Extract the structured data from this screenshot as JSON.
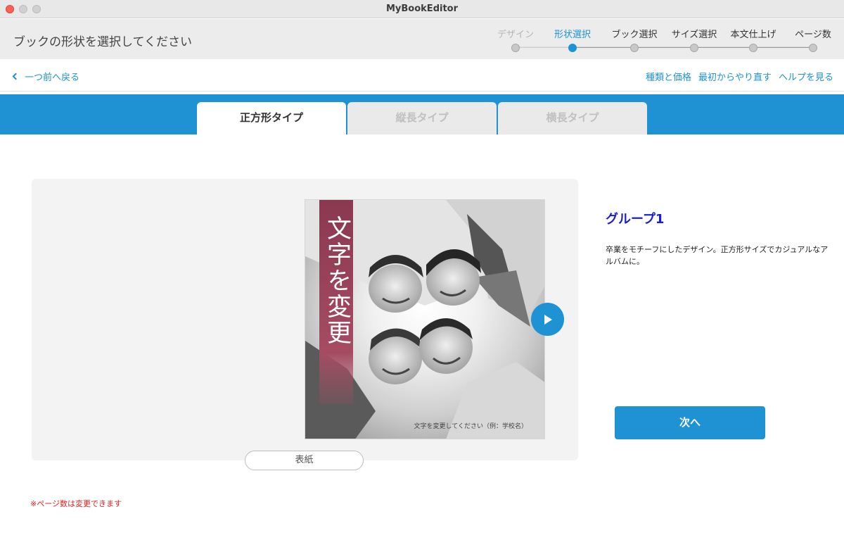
{
  "window": {
    "title": "MyBookEditor"
  },
  "header": {
    "heading": "ブックの形状を選択してください",
    "steps": [
      {
        "label": "デザイン",
        "state": "done"
      },
      {
        "label": "形状選択",
        "state": "active"
      },
      {
        "label": "ブック選択",
        "state": "pending"
      },
      {
        "label": "サイズ選択",
        "state": "pending"
      },
      {
        "label": "本文仕上げ",
        "state": "pending"
      },
      {
        "label": "ページ数",
        "state": "pending"
      }
    ]
  },
  "nav": {
    "back": "一つ前へ戻る",
    "links": [
      "種類と価格",
      "最初からやり直す",
      "ヘルプを見る"
    ]
  },
  "tabs": [
    {
      "label": "正方形タイプ",
      "selected": true
    },
    {
      "label": "縦長タイプ",
      "selected": false
    },
    {
      "label": "横長タイプ",
      "selected": false
    }
  ],
  "preview": {
    "cover_title": "文字を変更",
    "cover_caption": "文字を変更してください（例：学校名）",
    "page_label": "表紙"
  },
  "info": {
    "group_title": "グループ1",
    "description": "卒業をモチーフにしたデザイン。正方形サイズでカジュアルなアルバムに。",
    "next_button": "次へ"
  },
  "note": "※ページ数は変更できます",
  "colors": {
    "accent": "#1e92d2",
    "group_title": "#1a1ed0",
    "note": "#e02020"
  }
}
